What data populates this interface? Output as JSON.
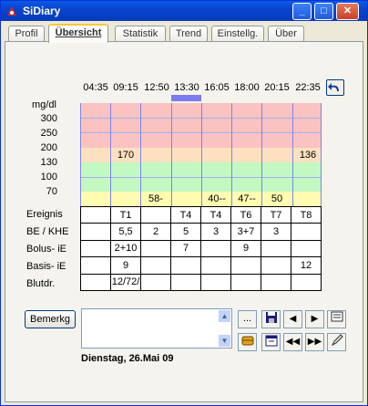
{
  "window": {
    "title": "SiDiary"
  },
  "tabs": [
    "Profil",
    "Übersicht",
    "Statistik",
    "Trend",
    "Einstellg.",
    "Über"
  ],
  "overview": {
    "times": [
      "04:35",
      "09:15",
      "12:50",
      "13:30",
      "16:05",
      "18:00",
      "20:15",
      "22:35"
    ],
    "unit": "mg/dl",
    "y_levels": [
      "300",
      "250",
      "200",
      "130",
      "100",
      "70"
    ],
    "glucose": [
      "",
      "170",
      "",
      "",
      "",
      "",
      "",
      "136"
    ],
    "low_row": [
      "",
      "",
      "58-",
      "",
      "40--",
      "47--",
      "50",
      ""
    ],
    "row_labels": [
      "Ereignis",
      "BE / KHE",
      "Bolus- iE",
      "Basis- iE",
      "Blutdr."
    ],
    "grid": [
      [
        "",
        "T1",
        "",
        "T4",
        "T4",
        "T6",
        "T7",
        "T8"
      ],
      [
        "",
        "5,5",
        "2",
        "5",
        "3",
        "3+7",
        "3",
        ""
      ],
      [
        "",
        "2+10",
        "",
        "7",
        "",
        "9",
        "",
        ""
      ],
      [
        "",
        "9",
        "",
        "",
        "",
        "",
        "",
        "12"
      ],
      [
        "",
        "12/72/",
        "",
        "",
        "",
        "",
        "",
        ""
      ]
    ],
    "colors": {
      "high": "#fbc2c2",
      "elevated": "#fde0c0",
      "target": "#c2f8c2",
      "low": "#fffcb2",
      "marker": "#7b7bf0"
    }
  },
  "notes": {
    "button_label": "Bemerkg",
    "text": "",
    "dots_label": "..."
  },
  "date": "Dienstag, 26.Mai 09"
}
